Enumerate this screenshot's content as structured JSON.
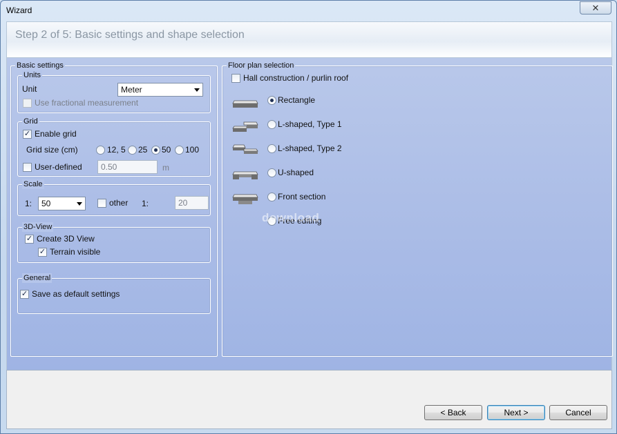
{
  "window": {
    "title": "Wizard",
    "close_glyph": "✕"
  },
  "header": {
    "title": "Step 2 of 5:  Basic settings and shape selection"
  },
  "basic": {
    "legend": "Basic settings",
    "units": {
      "legend": "Units",
      "unit_label": "Unit",
      "unit_value": "Meter",
      "fractional_label": "Use  fractional measurement",
      "fractional_checked": false
    },
    "grid": {
      "legend": "Grid",
      "enable_label": "Enable grid",
      "enable_checked": true,
      "size_label": "Grid size (cm)",
      "sizes": [
        "12, 5",
        "25",
        "50",
        "100"
      ],
      "selected_size": "50",
      "user_defined_label": "User-defined",
      "user_defined_checked": false,
      "user_defined_value": "0.50",
      "user_defined_unit": "m"
    },
    "scale": {
      "legend": "Scale",
      "prefix": "1:",
      "value": "50",
      "other_label": "other",
      "other_checked": false,
      "other_prefix": "1:",
      "other_value": "20"
    },
    "view3d": {
      "legend": "3D-View",
      "create_label": "Create 3D View",
      "create_checked": true,
      "terrain_label": "Terrain visible",
      "terrain_checked": true
    },
    "general": {
      "legend": "General",
      "default_label": "Save as default settings",
      "default_checked": true
    }
  },
  "floor": {
    "legend": "Floor plan selection",
    "hall_label": "Hall construction / purlin roof",
    "hall_checked": false,
    "shapes": [
      {
        "label": "Rectangle",
        "icon": "rectangle-shape-icon",
        "checked": true
      },
      {
        "label": "L-shaped, Type 1",
        "icon": "l-shape-type1-icon",
        "checked": false
      },
      {
        "label": "L-shaped, Type 2",
        "icon": "l-shape-type2-icon",
        "checked": false
      },
      {
        "label": "U-shaped",
        "icon": "u-shape-icon",
        "checked": false
      },
      {
        "label": "Front section",
        "icon": "front-section-icon",
        "checked": false
      },
      {
        "label": "Free editing",
        "icon": "",
        "checked": false
      }
    ]
  },
  "watermark": "download",
  "buttons": {
    "back": "< Back",
    "next": "Next >",
    "cancel": "Cancel"
  },
  "colors": {
    "content_bg": "#a9bbe6",
    "header_title": "#8a96a3",
    "default_button_border": "#3c7fb1"
  }
}
